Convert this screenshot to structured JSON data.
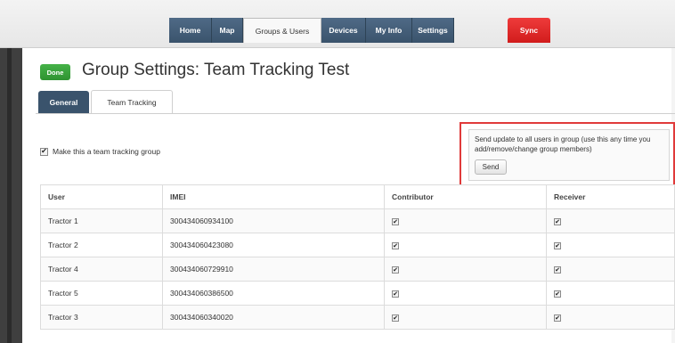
{
  "nav": {
    "items": [
      {
        "label": "Home",
        "active": false
      },
      {
        "label": "Map",
        "active": false
      },
      {
        "label": "Groups & Users",
        "active": true
      },
      {
        "label": "Devices",
        "active": false
      },
      {
        "label": "My Info",
        "active": false
      },
      {
        "label": "Settings",
        "active": false
      }
    ],
    "sync_label": "Sync"
  },
  "header": {
    "done_label": "Done",
    "title": "Group Settings: Team Tracking Test"
  },
  "tabs": [
    {
      "label": "General",
      "active": false
    },
    {
      "label": "Team Tracking",
      "active": true
    }
  ],
  "team_tracking": {
    "checkbox_label": "Make this a team tracking group",
    "checked": true,
    "send_box": {
      "text": "Send update to all users in group (use this any time you add/remove/change group members)",
      "button_label": "Send"
    }
  },
  "table": {
    "columns": [
      "User",
      "IMEI",
      "Contributor",
      "Receiver"
    ],
    "rows": [
      {
        "user": "Tractor 1",
        "imei": "300434060934100",
        "contributor": true,
        "receiver": true
      },
      {
        "user": "Tractor 2",
        "imei": "300434060423080",
        "contributor": true,
        "receiver": true
      },
      {
        "user": "Tractor 4",
        "imei": "300434060729910",
        "contributor": true,
        "receiver": true
      },
      {
        "user": "Tractor 5",
        "imei": "300434060386500",
        "contributor": true,
        "receiver": true
      },
      {
        "user": "Tractor 3",
        "imei": "300434060340020",
        "contributor": true,
        "receiver": true
      }
    ]
  },
  "colors": {
    "nav_bg": "#3a536c",
    "sync": "#e02828",
    "done": "#3aa43d",
    "highlight_border": "#e03a3a"
  }
}
